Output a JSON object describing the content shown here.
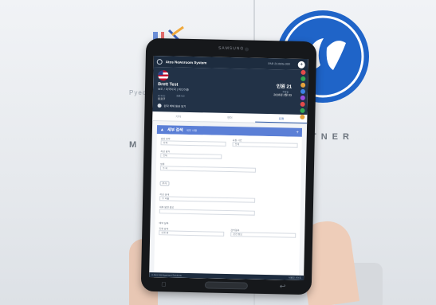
{
  "background": {
    "wall_text_left": "M",
    "wall_text_right": "TNER",
    "colors": {
      "ge_blue": "#1f64c8",
      "wall": "#e9ecf0"
    }
  },
  "tablet": {
    "brand": "SAMSUNG",
    "app": {
      "title": "Atos Newsroom System",
      "topbar_mid": "PAR 23.00/ta 000",
      "add_icon": "plus-icon"
    },
    "profile": {
      "name": "Brett Test",
      "role": "보도 / 미국미국 | 미디어종",
      "stats": [
        {
          "label": "ACR ID",
          "value": "11137"
        },
        {
          "label": "체류기간",
          "value": ""
        }
      ],
      "subscription": "원작 배체 월권 알기",
      "right_title": "인원 21",
      "right_stat_label": "추천일",
      "right_stat_value": "2018년 2월 03"
    },
    "tabs": [
      {
        "label": "기타",
        "active": false
      },
      {
        "label": "영어",
        "active": false
      },
      {
        "label": "요청",
        "active": true
      }
    ],
    "section": {
      "title": "세부 검색",
      "subtitle": "세부 사항",
      "add_icon": "plus-icon"
    },
    "form_fields": [
      {
        "label": "담당 분야",
        "value": "전체"
      },
      {
        "label": "요청 시간",
        "value": "전체"
      },
      {
        "label": "작성 방식",
        "value": "전체"
      },
      {
        "label": "분류",
        "value": "주 비"
      },
      {
        "label": "작성 상태",
        "value": "주 비율"
      },
      {
        "label": "세부 방향 정보",
        "value": ""
      },
      {
        "label": "예약 날짜",
        "value": ""
      },
      {
        "label": "진행 상태",
        "value": "진행 중"
      },
      {
        "label": "검색결과",
        "value": "관련 정보"
      }
    ],
    "chip_label": "추가",
    "status": {
      "left": "© Atos Management Solutions",
      "right": "서울원 사이트"
    },
    "side_icon_colors": [
      "#e34b4b",
      "#33a852",
      "#e6a23c",
      "#3c82e6",
      "#9b4de0",
      "#e34b4b",
      "#33a852",
      "#e6a23c"
    ]
  }
}
